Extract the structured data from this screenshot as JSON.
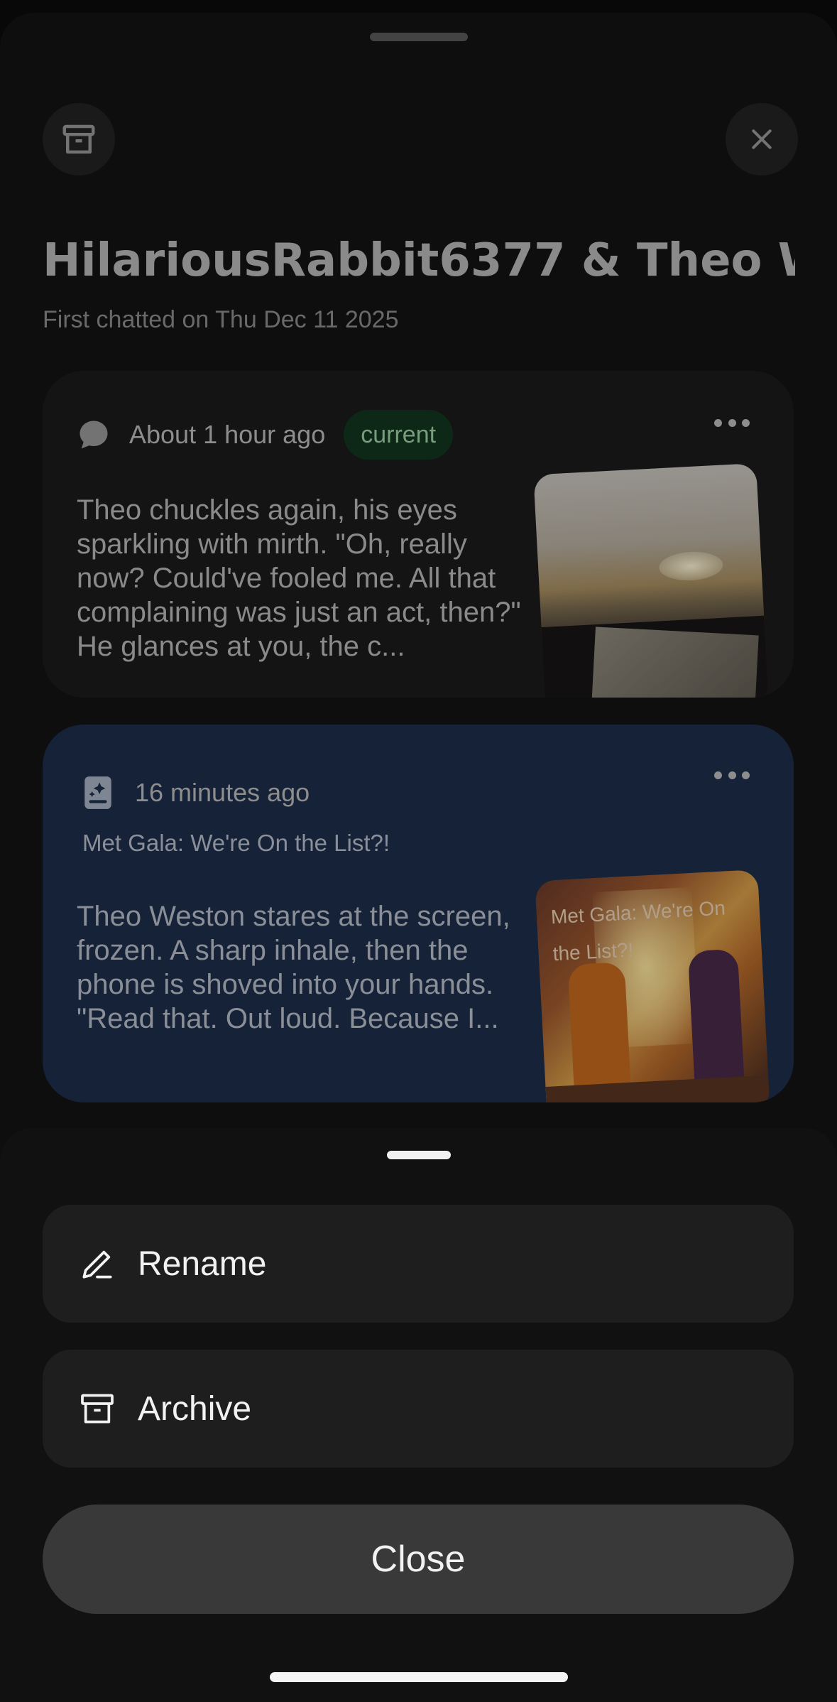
{
  "header": {
    "title": "HilariousRabbit6377 & Theo W",
    "subtitle": "First chatted on Thu Dec 11 2025",
    "archive_icon": "archive-icon",
    "close_icon": "close-icon"
  },
  "chats": [
    {
      "time": "About 1 hour ago",
      "badge": "current",
      "icon": "chat-bubble-icon",
      "text": "Theo chuckles again, his eyes sparkling with mirth. \"Oh, really now? Could've fooled me. All that complaining was just an act, then?\" He glances at you, the c...",
      "thumbnail": "road-trip-thumbnail"
    },
    {
      "time": "16 minutes ago",
      "icon": "story-book-icon",
      "story_title": "Met Gala: We're On the List?!",
      "text": "Theo Weston stares at the screen, frozen. A sharp inhale, then the phone is shoved into your hands.\n\"Read that. Out loud. Because I...",
      "thumbnail_caption": "Met Gala: We're On the List?!"
    }
  ],
  "action_sheet": {
    "rename_label": "Rename",
    "archive_label": "Archive",
    "close_label": "Close"
  },
  "colors": {
    "background": "#0b0b0b",
    "selected_card": "#1e2e4a",
    "badge_bg": "#12361f",
    "badge_text": "#9fd0a9"
  }
}
